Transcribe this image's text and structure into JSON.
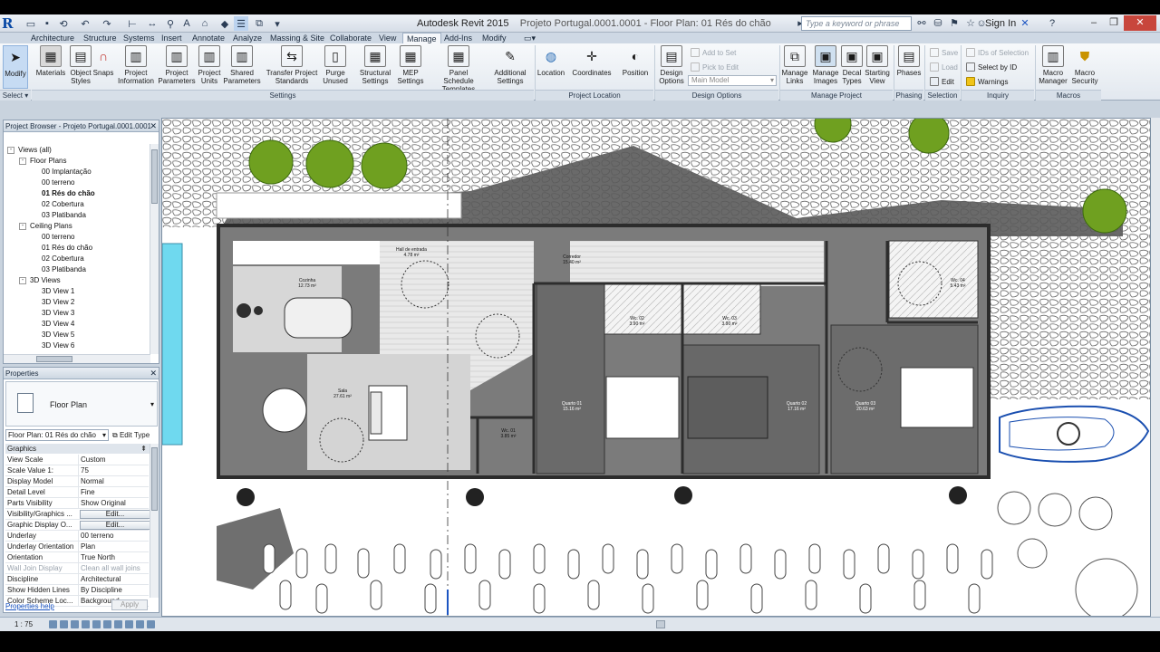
{
  "window": {
    "app_title": "Autodesk Revit 2015",
    "doc_title": "Projeto Portugal.0001.0001 - Floor Plan: 01 Rés do chão",
    "search_placeholder": "Type a keyword or phrase",
    "sign_in": "Sign In"
  },
  "tabs": [
    "Architecture",
    "Structure",
    "Systems",
    "Insert",
    "Annotate",
    "Analyze",
    "Massing & Site",
    "Collaborate",
    "View",
    "Manage",
    "Add-Ins",
    "Modify"
  ],
  "active_tab": "Manage",
  "ribbon": {
    "select_label": "Select",
    "modify": "Modify",
    "settings": {
      "label": "Settings",
      "buttons": [
        "Materials",
        "Object Styles",
        "Snaps",
        "Project Information",
        "Project Parameters",
        "Project Units",
        "Shared Parameters",
        "Transfer Project Standards",
        "Purge Unused",
        "Structural Settings",
        "MEP Settings",
        "Panel Schedule Templates",
        "Additional Settings"
      ]
    },
    "project_location": {
      "label": "Project Location",
      "buttons": [
        "Location",
        "Coordinates",
        "Position"
      ]
    },
    "design_options": {
      "label": "Design Options",
      "button": "Design Options",
      "add_to_set": "Add to Set",
      "pick_to_edit": "Pick to Edit",
      "main_model": "Main Model"
    },
    "manage_project": {
      "label": "Manage Project",
      "buttons": [
        "Manage Links",
        "Manage Images",
        "Decal Types",
        "Starting View"
      ]
    },
    "phasing": {
      "label": "Phasing",
      "button": "Phases"
    },
    "selection": {
      "label": "Selection",
      "save": "Save",
      "load": "Load",
      "edit": "Edit"
    },
    "inquiry": {
      "label": "Inquiry",
      "ids": "IDs of Selection",
      "select_by_id": "Select by ID",
      "warnings": "Warnings"
    },
    "macros": {
      "label": "Macros",
      "buttons": [
        "Macro Manager",
        "Macro Security"
      ]
    }
  },
  "project_browser": {
    "title": "Project Browser - Projeto Portugal.0001.0001",
    "tree": [
      {
        "label": "Views (all)",
        "level": 0,
        "toggle": "-"
      },
      {
        "label": "Floor Plans",
        "level": 1,
        "toggle": "-"
      },
      {
        "label": "00 Implantação",
        "level": 2
      },
      {
        "label": "00 terreno",
        "level": 2
      },
      {
        "label": "01 Rés do chão",
        "level": 2,
        "bold": true
      },
      {
        "label": "02 Cobertura",
        "level": 2
      },
      {
        "label": "03 Platibanda",
        "level": 2
      },
      {
        "label": "Ceiling Plans",
        "level": 1,
        "toggle": "-"
      },
      {
        "label": "00 terreno",
        "level": 2
      },
      {
        "label": "01 Rés do chão",
        "level": 2
      },
      {
        "label": "02 Cobertura",
        "level": 2
      },
      {
        "label": "03 Platibanda",
        "level": 2
      },
      {
        "label": "3D Views",
        "level": 1,
        "toggle": "-"
      },
      {
        "label": "3D View 1",
        "level": 2
      },
      {
        "label": "3D View 2",
        "level": 2
      },
      {
        "label": "3D View 3",
        "level": 2
      },
      {
        "label": "3D View 4",
        "level": 2
      },
      {
        "label": "3D View 5",
        "level": 2
      },
      {
        "label": "3D View 6",
        "level": 2
      }
    ]
  },
  "properties": {
    "title": "Properties",
    "type_name": "Floor Plan",
    "view_selector": "Floor Plan: 01 Rés do chão",
    "edit_type": "Edit Type",
    "group": "Graphics",
    "rows": [
      {
        "k": "View Scale",
        "v": "Custom"
      },
      {
        "k": "Scale Value    1:",
        "v": "75"
      },
      {
        "k": "Display Model",
        "v": "Normal"
      },
      {
        "k": "Detail Level",
        "v": "Fine"
      },
      {
        "k": "Parts Visibility",
        "v": "Show Original"
      },
      {
        "k": "Visibility/Graphics ...",
        "v": "Edit...",
        "button": true
      },
      {
        "k": "Graphic Display O...",
        "v": "Edit...",
        "button": true
      },
      {
        "k": "Underlay",
        "v": "00 terreno"
      },
      {
        "k": "Underlay Orientation",
        "v": "Plan"
      },
      {
        "k": "Orientation",
        "v": "True North"
      },
      {
        "k": "Wall Join Display",
        "v": "Clean all wall joins",
        "dim": true
      },
      {
        "k": "Discipline",
        "v": "Architectural"
      },
      {
        "k": "Show Hidden Lines",
        "v": "By Discipline"
      },
      {
        "k": "Color Scheme Loc...",
        "v": "Background"
      }
    ],
    "help": "Properties help",
    "apply": "Apply"
  },
  "rooms": [
    {
      "name": "Cozinha",
      "area": "12.73 m²"
    },
    {
      "name": "Hall de entrada",
      "area": "4.78 m²"
    },
    {
      "name": "Corredor",
      "area": "15.40 m²"
    },
    {
      "name": "Sala",
      "area": "27.61 m²"
    },
    {
      "name": "Wc. 01",
      "area": "3.85 m²"
    },
    {
      "name": "Wc. 02",
      "area": "3.90 m²"
    },
    {
      "name": "Wc. 03",
      "area": "3.90 m²"
    },
    {
      "name": "Wc. 04",
      "area": "5.43 m²"
    },
    {
      "name": "Quarto 01",
      "area": "15.16 m²"
    },
    {
      "name": "Quarto 02",
      "area": "17.16 m²"
    },
    {
      "name": "Quarto 03",
      "area": "20.63 m²"
    }
  ],
  "status": {
    "scale": "1 : 75"
  },
  "colors": {
    "accent": "#1c55c2",
    "wall": "#444444",
    "floor": "#7a7a7a",
    "grass": "#6fa020",
    "pool": "#6fd9ef",
    "car": "#1a4fb0"
  }
}
